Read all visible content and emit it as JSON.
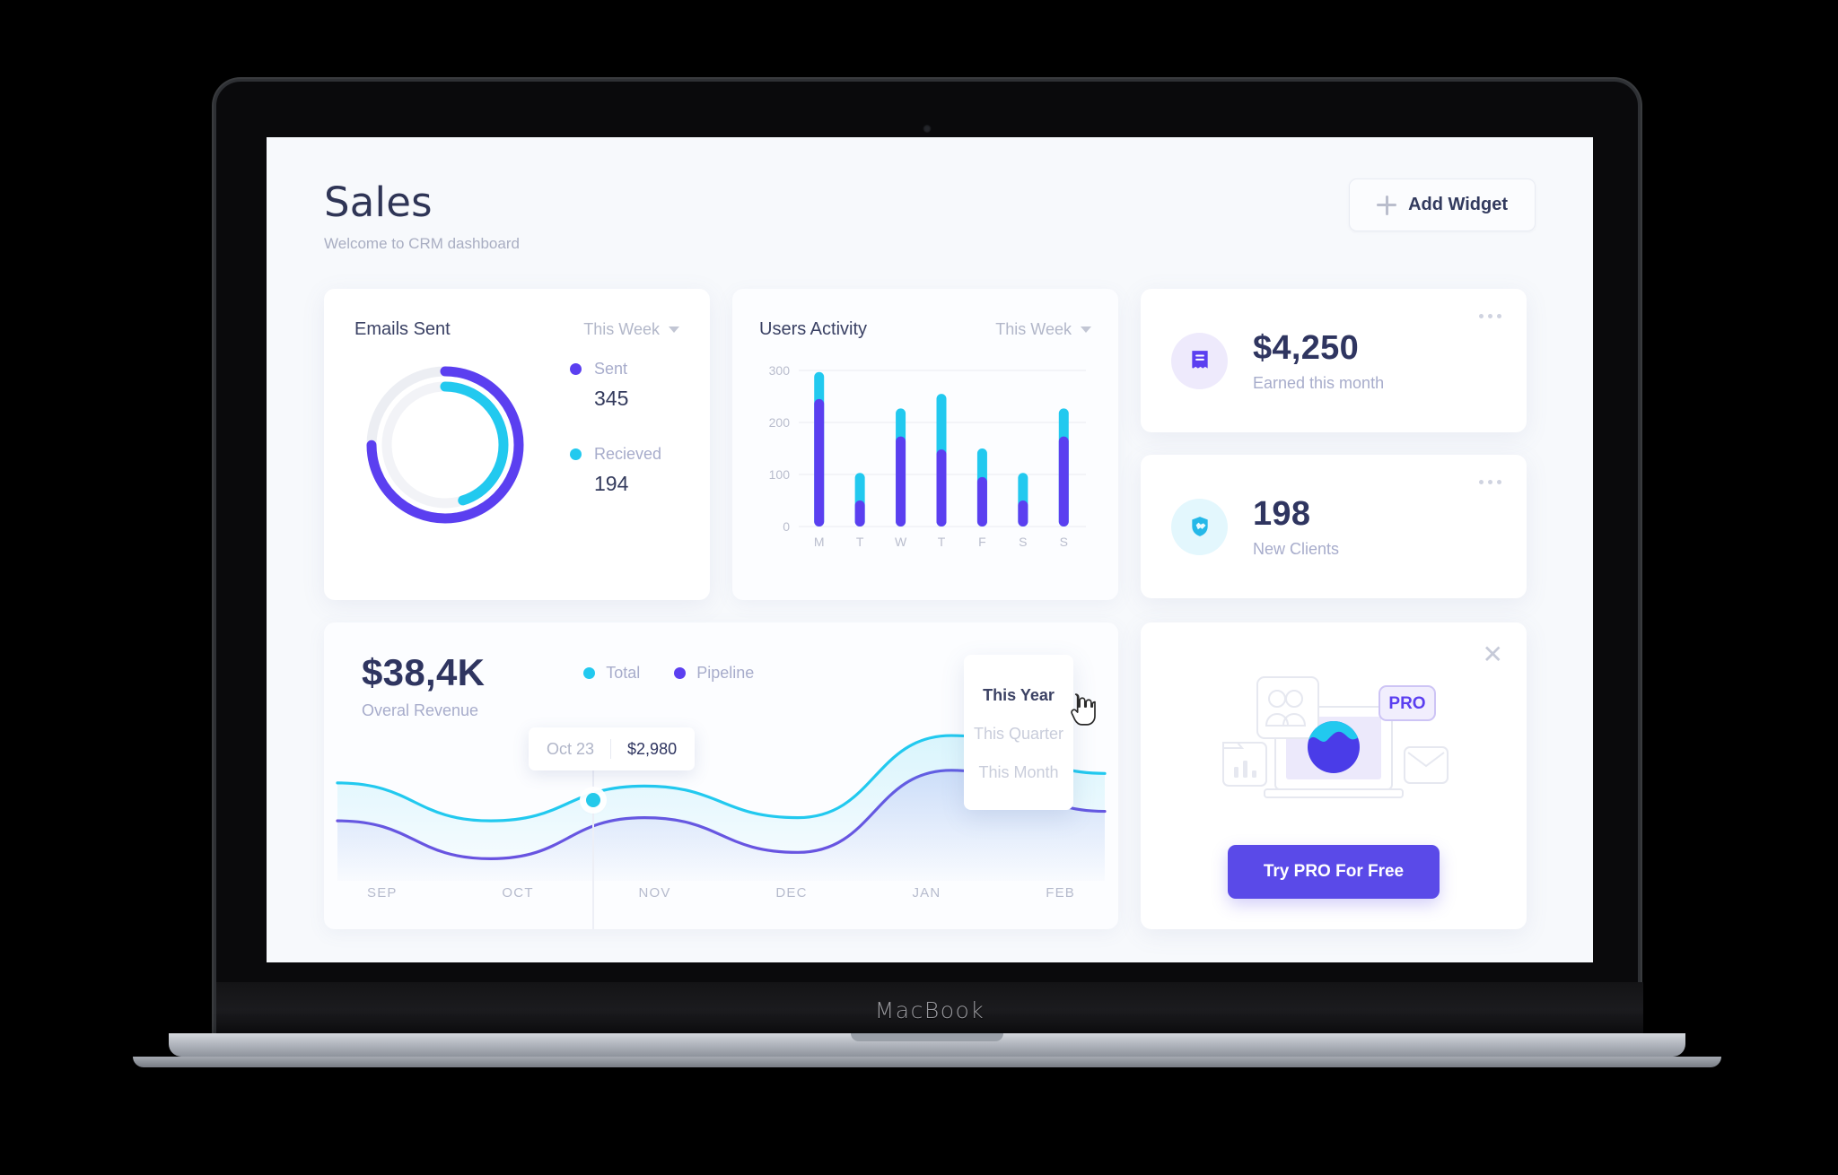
{
  "device": {
    "brand_label": "MacBook"
  },
  "header": {
    "title": "Sales",
    "subtitle": "Welcome to CRM dashboard",
    "add_widget_label": "Add Widget"
  },
  "emails_card": {
    "title": "Emails Sent",
    "period": "This Week",
    "legend": [
      {
        "name": "Sent",
        "value": "345",
        "color": "#5b3ff0"
      },
      {
        "name": "Recieved",
        "value": "194",
        "color": "#22c9ef"
      }
    ]
  },
  "activity_card": {
    "title": "Users Activity",
    "period": "This Week"
  },
  "stats": [
    {
      "value": "$4,250",
      "label": "Earned this month",
      "icon": "receipt-icon",
      "accent": "#5b3ff0"
    },
    {
      "value": "198",
      "label": "New Clients",
      "icon": "handshake-shield-icon",
      "accent": "#25b8e8"
    }
  ],
  "revenue_card": {
    "amount": "$38,4K",
    "label": "Overal Revenue",
    "legend": [
      {
        "name": "Total",
        "color": "#22c9ef"
      },
      {
        "name": "Pipeline",
        "color": "#5b3ff0"
      }
    ],
    "tooltip": {
      "date": "Oct 23",
      "value": "$2,980"
    },
    "dropdown": {
      "selected": "This Year",
      "options": [
        "This Year",
        "This Quarter",
        "This Month"
      ]
    }
  },
  "pro_card": {
    "badge": "PRO",
    "button_label": "Try PRO For Free",
    "close_label": "✕"
  },
  "chart_data": [
    {
      "type": "pie",
      "title": "Emails Sent",
      "subtype": "donut-dual-ring",
      "series": [
        {
          "name": "Sent",
          "value": 345,
          "color": "#5b3ff0",
          "ring": "outer",
          "fraction": 0.75
        },
        {
          "name": "Recieved",
          "value": 194,
          "color": "#22c9ef",
          "ring": "inner",
          "fraction": 0.45
        }
      ],
      "legend_position": "right"
    },
    {
      "type": "bar",
      "title": "Users Activity",
      "subtype": "stacked",
      "categories": [
        "M",
        "T",
        "W",
        "T",
        "F",
        "S",
        "S"
      ],
      "series": [
        {
          "name": "base",
          "color": "#5b3ff0",
          "values": [
            245,
            50,
            173,
            148,
            95,
            50,
            173
          ]
        },
        {
          "name": "top",
          "color": "#22c9ef",
          "values": [
            52,
            53,
            54,
            107,
            55,
            53,
            54
          ]
        }
      ],
      "totals": [
        297,
        103,
        227,
        255,
        150,
        103,
        227
      ],
      "ylim": [
        0,
        300
      ],
      "yticks": [
        0,
        100,
        200,
        300
      ],
      "ytick_labels": [
        "0",
        "100",
        "200",
        "300"
      ],
      "xlabel": "",
      "ylabel": "",
      "grid": true
    },
    {
      "type": "area",
      "title": "Overal Revenue",
      "x": [
        "SEP",
        "OCT",
        "NOV",
        "DEC",
        "JAN",
        "FEB"
      ],
      "series": [
        {
          "name": "Total",
          "color": "#22c9ef",
          "values": [
            62,
            38,
            60,
            40,
            92,
            68
          ]
        },
        {
          "name": "Pipeline",
          "color": "#6b4fe0",
          "values": [
            38,
            14,
            40,
            18,
            70,
            44
          ]
        }
      ],
      "annotations": [
        {
          "x": "Oct 23",
          "y": "$2,980",
          "series": "Total"
        }
      ],
      "grid": false,
      "legend_position": "top-right"
    }
  ]
}
